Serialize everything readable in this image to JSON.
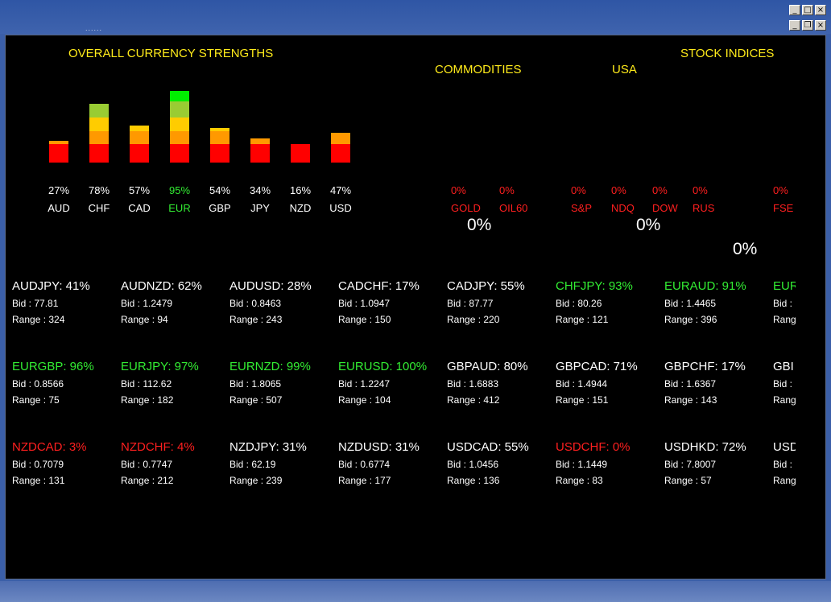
{
  "window": {
    "titlebar_dots": "......",
    "buttons_row1": [
      "_",
      "□",
      "×"
    ],
    "buttons_row2": [
      "_",
      "❐",
      "×"
    ]
  },
  "headers": {
    "strengths": "OVERALL CURRENCY STRENGTHS",
    "commodities": "COMMODITIES",
    "usa": "USA",
    "stock_indices": "STOCK INDICES"
  },
  "colors": {
    "header": "#ffeb1a",
    "red": "#ff0000",
    "orange": "#ff9900",
    "yellow": "#ffcc00",
    "yellowgreen": "#99cc33",
    "green": "#00ee00"
  },
  "currencies": [
    {
      "code": "AUD",
      "pct": "27%",
      "value": 27,
      "highlight": "normal"
    },
    {
      "code": "CHF",
      "pct": "78%",
      "value": 78,
      "highlight": "normal"
    },
    {
      "code": "CAD",
      "pct": "57%",
      "value": 57,
      "highlight": "normal"
    },
    {
      "code": "EUR",
      "pct": "95%",
      "value": 95,
      "highlight": "green"
    },
    {
      "code": "GBP",
      "pct": "54%",
      "value": 54,
      "highlight": "normal"
    },
    {
      "code": "JPY",
      "pct": "34%",
      "value": 34,
      "highlight": "normal"
    },
    {
      "code": "NZD",
      "pct": "16%",
      "value": 16,
      "highlight": "normal"
    },
    {
      "code": "USD",
      "pct": "47%",
      "value": 47,
      "highlight": "normal"
    }
  ],
  "indices": [
    {
      "name": "GOLD",
      "pct": "0%"
    },
    {
      "name": "OIL60",
      "pct": "0%"
    },
    {
      "name": "S&P",
      "pct": "0%"
    },
    {
      "name": "NDQ",
      "pct": "0%"
    },
    {
      "name": "DOW",
      "pct": "0%"
    },
    {
      "name": "RUS",
      "pct": "0%"
    },
    {
      "name": "FSE",
      "pct": "0%"
    }
  ],
  "group_totals": {
    "commodities": "0%",
    "usa": "0%",
    "stock_indices": "0%"
  },
  "pairs": [
    [
      {
        "name": "AUDJPY: 41%",
        "bid": "Bid : 77.81",
        "range": "Range : 324",
        "color": "white"
      },
      {
        "name": "AUDNZD: 62%",
        "bid": "Bid : 1.2479",
        "range": "Range : 94",
        "color": "white"
      },
      {
        "name": "AUDUSD: 28%",
        "bid": "Bid : 0.8463",
        "range": "Range : 243",
        "color": "white"
      },
      {
        "name": "CADCHF: 17%",
        "bid": "Bid : 1.0947",
        "range": "Range : 150",
        "color": "white"
      },
      {
        "name": "CADJPY: 55%",
        "bid": "Bid : 87.77",
        "range": "Range : 220",
        "color": "white"
      },
      {
        "name": "CHFJPY: 93%",
        "bid": "Bid : 80.26",
        "range": "Range : 121",
        "color": "green"
      },
      {
        "name": "EURAUD: 91%",
        "bid": "Bid : 1.4465",
        "range": "Range : 396",
        "color": "green"
      },
      {
        "name": "EUR",
        "bid": "Bid :",
        "range": "Rang",
        "color": "green"
      }
    ],
    [
      {
        "name": "EURGBP: 96%",
        "bid": "Bid : 0.8566",
        "range": "Range : 75",
        "color": "green"
      },
      {
        "name": "EURJPY: 97%",
        "bid": "Bid : 112.62",
        "range": "Range : 182",
        "color": "green"
      },
      {
        "name": "EURNZD: 99%",
        "bid": "Bid : 1.8065",
        "range": "Range : 507",
        "color": "green"
      },
      {
        "name": "EURUSD: 100%",
        "bid": "Bid : 1.2247",
        "range": "Range : 104",
        "color": "green"
      },
      {
        "name": "GBPAUD: 80%",
        "bid": "Bid : 1.6883",
        "range": "Range : 412",
        "color": "white"
      },
      {
        "name": "GBPCAD: 71%",
        "bid": "Bid : 1.4944",
        "range": "Range : 151",
        "color": "white"
      },
      {
        "name": "GBPCHF: 17%",
        "bid": "Bid : 1.6367",
        "range": "Range : 143",
        "color": "white"
      },
      {
        "name": "GBI",
        "bid": "Bid :",
        "range": "Rang",
        "color": "white"
      }
    ],
    [
      {
        "name": "NZDCAD: 3%",
        "bid": "Bid : 0.7079",
        "range": "Range : 131",
        "color": "red"
      },
      {
        "name": "NZDCHF: 4%",
        "bid": "Bid : 0.7747",
        "range": "Range : 212",
        "color": "red"
      },
      {
        "name": "NZDJPY: 31%",
        "bid": "Bid : 62.19",
        "range": "Range : 239",
        "color": "white"
      },
      {
        "name": "NZDUSD: 31%",
        "bid": "Bid : 0.6774",
        "range": "Range : 177",
        "color": "white"
      },
      {
        "name": "USDCAD: 55%",
        "bid": "Bid : 1.0456",
        "range": "Range : 136",
        "color": "white"
      },
      {
        "name": "USDCHF: 0%",
        "bid": "Bid : 1.1449",
        "range": "Range : 83",
        "color": "red"
      },
      {
        "name": "USDHKD: 72%",
        "bid": "Bid : 7.8007",
        "range": "Range : 57",
        "color": "white"
      },
      {
        "name": "USD",
        "bid": "Bid :",
        "range": "Rang",
        "color": "white"
      }
    ]
  ]
}
